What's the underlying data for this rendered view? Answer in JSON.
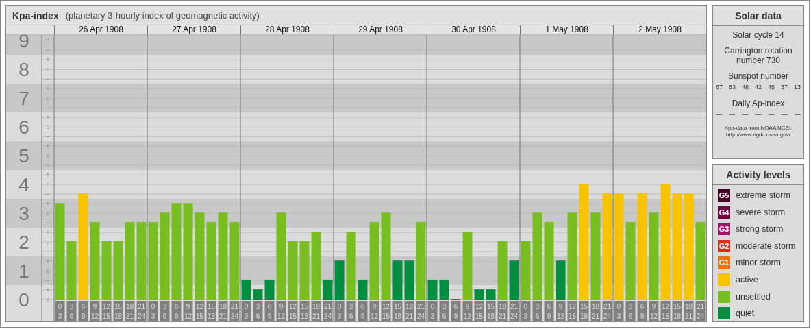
{
  "main_panel": {
    "title": "Kpa-index",
    "subtitle": "(planetary 3-hourly index of geomagnetic activity)",
    "days": [
      "26 Apr 1908",
      "27 Apr 1908",
      "28 Apr 1908",
      "29 Apr 1908",
      "30 Apr 1908",
      "1 May 1908",
      "2 May 1908"
    ],
    "sublevel_labels": [
      "o",
      "−",
      "+",
      "o",
      "−",
      "+",
      "o",
      "−",
      "+",
      "o",
      "−",
      "+",
      "o",
      "−",
      "+",
      "o",
      "−",
      "+",
      "o",
      "−",
      "+",
      "o",
      "−",
      "+",
      "o",
      "−",
      "+",
      "o"
    ],
    "chart_data": {
      "type": "bar",
      "ylim": [
        0,
        9.2
      ],
      "grid": true,
      "yticks": [
        9,
        8,
        7,
        6,
        5,
        4,
        3,
        2,
        1,
        0
      ],
      "categories": [
        "0 3",
        "3 6",
        "6 9",
        "9 12",
        "12 15",
        "15 18",
        "18 21",
        "21 24",
        "0 3",
        "3 6",
        "6 9",
        "9 12",
        "12 15",
        "15 18",
        "18 21",
        "21 24",
        "0 3",
        "3 6",
        "6 9",
        "9 12",
        "12 15",
        "15 18",
        "18 21",
        "21 24",
        "0 3",
        "3 6",
        "6 9",
        "9 12",
        "12 15",
        "15 18",
        "18 21",
        "21 24",
        "0 3",
        "3 6",
        "6 9",
        "9 12",
        "12 15",
        "15 18",
        "18 21",
        "21 24",
        "0 3",
        "3 6",
        "6 9",
        "9 12",
        "12 15",
        "15 18",
        "18 21",
        "21 24",
        "0 3",
        "3 6",
        "6 9",
        "9 12",
        "12 15",
        "15 18",
        "18 21",
        "21 24"
      ],
      "values": [
        3.33,
        2,
        3.67,
        2.67,
        2,
        2,
        2.67,
        2.67,
        2.67,
        3,
        3.33,
        3.33,
        3,
        2.67,
        3,
        2.67,
        0.67,
        0.33,
        0.67,
        3,
        2,
        2,
        2.33,
        0.67,
        1.33,
        2.33,
        0.67,
        2.67,
        3,
        1.33,
        1.33,
        2.67,
        0.67,
        0.67,
        0,
        2.33,
        0.33,
        0.33,
        2,
        1.33,
        2,
        3,
        2.67,
        1.33,
        3,
        4,
        3,
        3.67,
        3.67,
        2.67,
        3.67,
        3,
        4,
        3.67,
        3.67,
        2.67
      ]
    }
  },
  "solar_data": {
    "title": "Solar data",
    "solar_cycle": "Solar cycle 14",
    "carrington": "Carrington rotation number 730",
    "sunspot_heading": "Sunspot number",
    "sunspot_numbers": [
      "67",
      "83",
      "48",
      "42",
      "45",
      "37",
      "13"
    ],
    "ap_heading": "Daily Ap-index",
    "ap_values": [
      "—",
      "—",
      "—",
      "—",
      "—",
      "—",
      "—"
    ],
    "source": "Kpa-data from NOAA NCEI:",
    "source_url": "http://www.ngdc.noaa.gov/"
  },
  "activity_levels": {
    "title": "Activity levels",
    "items": [
      {
        "badge": "G5",
        "label": "extreme storm",
        "color": "#4a0024"
      },
      {
        "badge": "G4",
        "label": "severe storm",
        "color": "#6e0040"
      },
      {
        "badge": "G3",
        "label": "strong storm",
        "color": "#a8106a"
      },
      {
        "badge": "G2",
        "label": "moderate storm",
        "color": "#d8301c"
      },
      {
        "badge": "G1",
        "label": "minor storm",
        "color": "#e87416"
      },
      {
        "label": "active",
        "color": "#f8c400"
      },
      {
        "label": "unsettled",
        "color": "#78be20"
      },
      {
        "label": "quiet",
        "color": "#008e40"
      }
    ]
  }
}
